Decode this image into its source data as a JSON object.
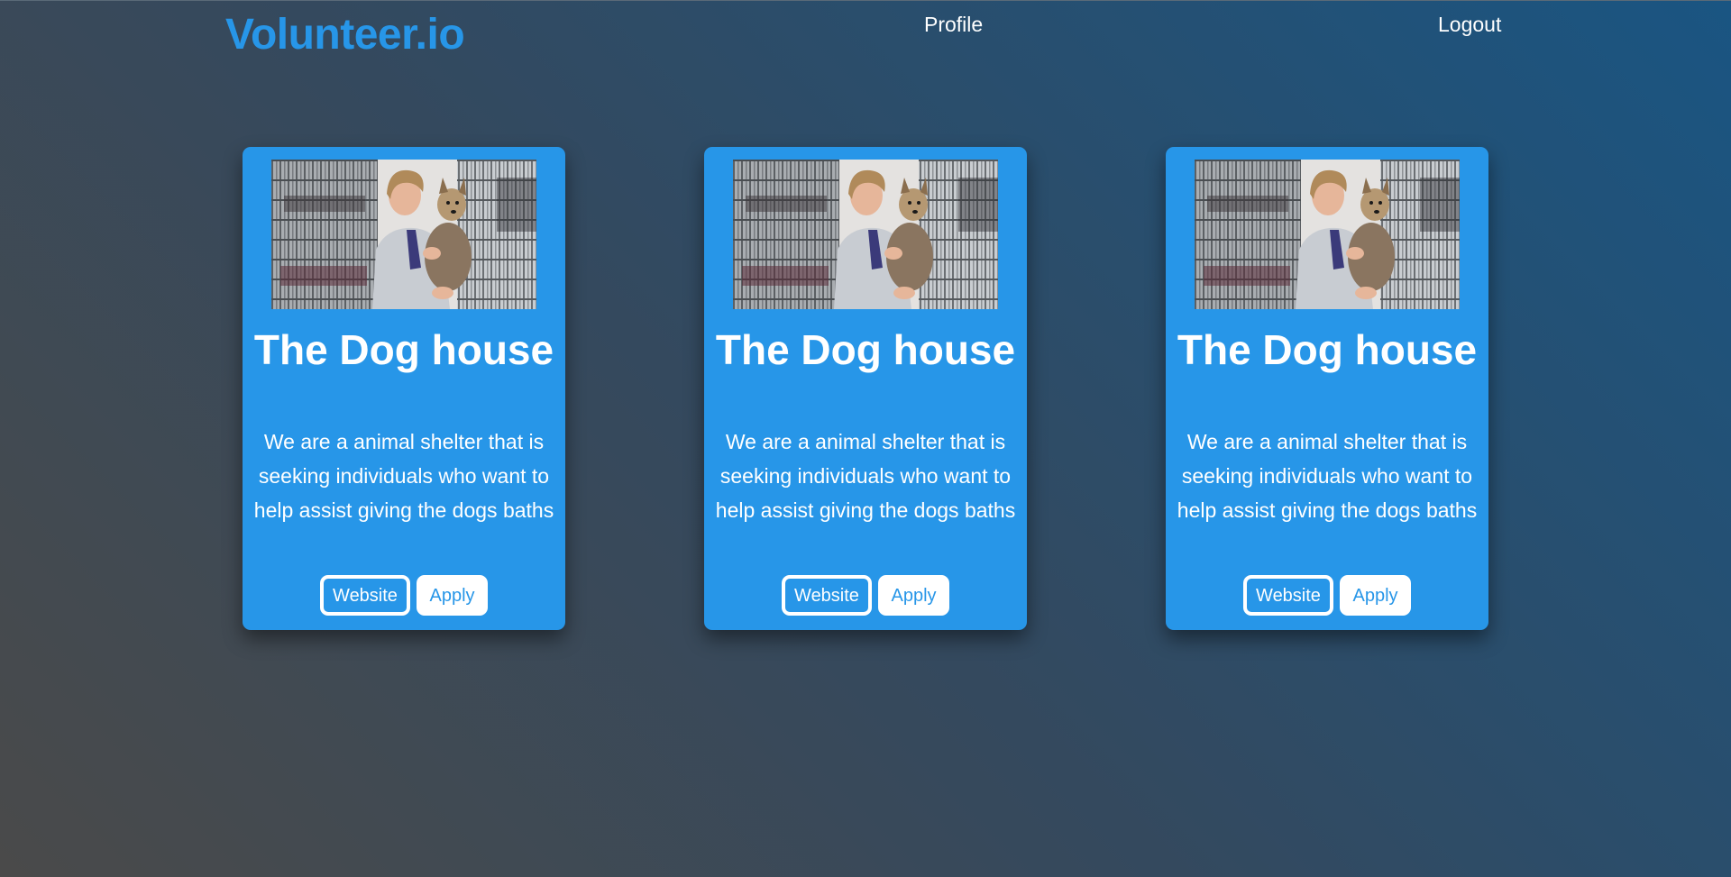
{
  "nav": {
    "brand": "Volunteer.io",
    "links": [
      "Profile",
      "Logout"
    ]
  },
  "colors": {
    "accent": "#2796e8",
    "text_on_accent": "#ffffff"
  },
  "cards": [
    {
      "title": "The Dog house",
      "description": "We are a animal shelter that is seeking individuals who want to help assist giving the dogs baths",
      "website_label": "Website",
      "apply_label": "Apply"
    },
    {
      "title": "The Dog house",
      "description": "We are a animal shelter that is seeking individuals who want to help assist giving the dogs baths",
      "website_label": "Website",
      "apply_label": "Apply"
    },
    {
      "title": "The Dog house",
      "description": "We are a animal shelter that is seeking individuals who want to help assist giving the dogs baths",
      "website_label": "Website",
      "apply_label": "Apply"
    }
  ]
}
